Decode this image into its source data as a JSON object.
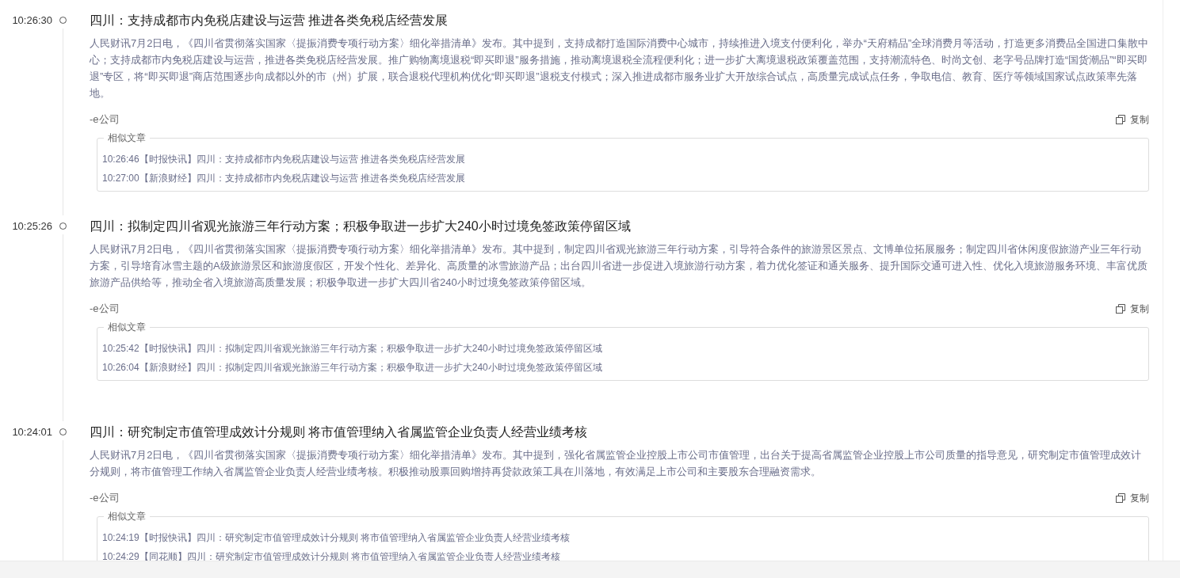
{
  "items": [
    {
      "time": "10:26:30",
      "title": "四川：支持成都市内免税店建设与运营 推进各类免税店经营发展",
      "body": "人民财讯7月2日电，《四川省贯彻落实国家〈提振消费专项行动方案〉细化举措清单》发布。其中提到，支持成都打造国际消费中心城市，持续推进入境支付便利化，举办“天府精品”全球消费月等活动，打造更多消费品全国进口集散中心；支持成都市内免税店建设与运营，推进各类免税店经营发展。推广购物离境退税“即买即退”服务措施，推动离境退税全流程便利化；进一步扩大离境退税政策覆盖范围，支持潮流特色、时尚文创、老字号品牌打造“国货潮品”“即买即退”专区，将“即买即退”商店范围逐步向成都以外的市（州）扩展，联合退税代理机构优化“即买即退”退税支付模式；深入推进成都市服务业扩大开放综合试点，高质量完成试点任务，争取电信、教育、医疗等领域国家试点政策率先落地。",
      "source": "-e公司",
      "copy": "复制",
      "related_label": "相似文章",
      "related": [
        "10:26:46【时报快讯】四川：支持成都市内免税店建设与运营 推进各类免税店经营发展",
        "10:27:00【新浪财经】四川：支持成都市内免税店建设与运营 推进各类免税店经营发展"
      ]
    },
    {
      "time": "10:25:26",
      "title": "四川：拟制定四川省观光旅游三年行动方案；积极争取进一步扩大240小时过境免签政策停留区域",
      "body": "人民财讯7月2日电，《四川省贯彻落实国家〈提振消费专项行动方案〉细化举措清单》发布。其中提到，制定四川省观光旅游三年行动方案，引导符合条件的旅游景区景点、文博单位拓展服务；制定四川省休闲度假旅游产业三年行动方案，引导培育冰雪主题的A级旅游景区和旅游度假区，开发个性化、差异化、高质量的冰雪旅游产品；出台四川省进一步促进入境旅游行动方案，着力优化签证和通关服务、提升国际交通可进入性、优化入境旅游服务环境、丰富优质旅游产品供给等，推动全省入境旅游高质量发展；积极争取进一步扩大四川省240小时过境免签政策停留区域。",
      "source": "-e公司",
      "copy": "复制",
      "related_label": "相似文章",
      "related": [
        "10:25:42【时报快讯】四川：拟制定四川省观光旅游三年行动方案；积极争取进一步扩大240小时过境免签政策停留区域",
        "10:26:04【新浪财经】四川：拟制定四川省观光旅游三年行动方案；积极争取进一步扩大240小时过境免签政策停留区域"
      ]
    },
    {
      "time": "10:24:01",
      "title": "四川：研究制定市值管理成效计分规则 将市值管理纳入省属监管企业负责人经营业绩考核",
      "body": "人民财讯7月2日电，《四川省贯彻落实国家〈提振消费专项行动方案〉细化举措清单》发布。其中提到，强化省属监管企业控股上市公司市值管理，出台关于提高省属监管企业控股上市公司质量的指导意见，研究制定市值管理成效计分规则，将市值管理工作纳入省属监管企业负责人经营业绩考核。积极推动股票回购增持再贷款政策工具在川落地，有效满足上市公司和主要股东合理融资需求。",
      "source": "-e公司",
      "copy": "复制",
      "related_label": "相似文章",
      "related": [
        "10:24:19【时报快讯】四川：研究制定市值管理成效计分规则 将市值管理纳入省属监管企业负责人经营业绩考核",
        "10:24:29【同花顺】四川：研究制定市值管理成效计分规则 将市值管理纳入省属监管企业负责人经营业绩考核"
      ]
    }
  ]
}
